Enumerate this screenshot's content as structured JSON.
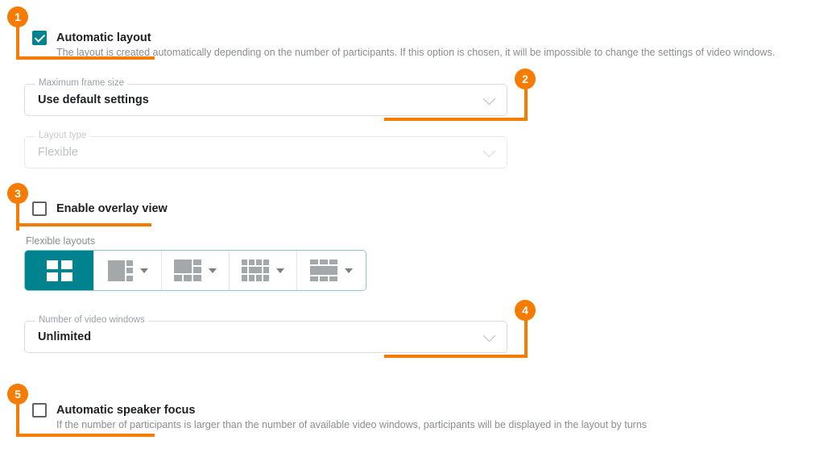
{
  "theme": {
    "accent_teal": "#00838f",
    "callout_orange": "#f57c00",
    "text_primary": "#202124",
    "text_muted": "#8a8d91",
    "border": "#dadce0"
  },
  "callouts": [
    {
      "number": "1"
    },
    {
      "number": "2"
    },
    {
      "number": "3"
    },
    {
      "number": "4"
    },
    {
      "number": "5"
    }
  ],
  "automatic_layout": {
    "label": "Automatic layout",
    "description": "The layout is created automatically depending on the number of participants. If this option is chosen, it will be impossible to change the settings of video windows.",
    "checked": "true"
  },
  "maximum_frame_size": {
    "label": "Maximum frame size",
    "value": "Use default settings",
    "icon": "chevron-down-icon"
  },
  "layout_type": {
    "label": "Layout type",
    "value": "Flexible",
    "icon": "chevron-down-icon",
    "disabled": "true"
  },
  "enable_overlay_view": {
    "label": "Enable overlay view",
    "checked": "false"
  },
  "flexible_layouts": {
    "label": "Flexible layouts",
    "options": [
      {
        "name": "grid-2x2-layout-icon",
        "selected": "true",
        "has_caret": "false"
      },
      {
        "name": "one-large-left-three-right-layout-icon",
        "selected": "false",
        "has_caret": "true"
      },
      {
        "name": "one-large-two-right-three-bottom-layout-icon",
        "selected": "false",
        "has_caret": "true"
      },
      {
        "name": "center-stage-surrounded-layout-icon",
        "selected": "false",
        "has_caret": "true"
      },
      {
        "name": "wide-center-three-top-three-bottom-layout-icon",
        "selected": "false",
        "has_caret": "true"
      }
    ]
  },
  "number_of_video_windows": {
    "label": "Number of video windows",
    "value": "Unlimited",
    "icon": "chevron-down-icon"
  },
  "automatic_speaker_focus": {
    "label": "Automatic speaker focus",
    "description": "If the number of participants is larger than the number of available video windows, participants will be displayed in the layout by turns",
    "checked": "false"
  }
}
